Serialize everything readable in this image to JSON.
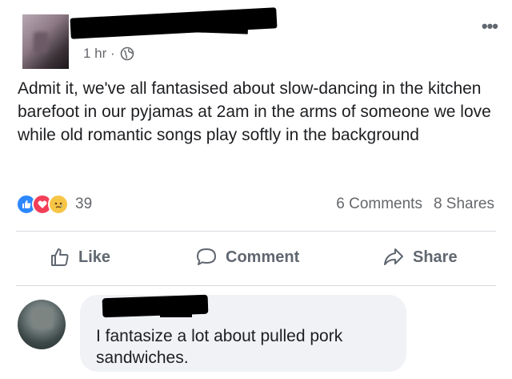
{
  "post": {
    "timestamp": "1 hr ·",
    "text": "Admit it, we've all fantasised about slow-dancing in the kitchen barefoot in our pyjamas at 2am in the arms of someone we love while old romantic songs play softly in the background",
    "reaction_count": "39",
    "comments_count": "6 Comments",
    "shares_count": "8 Shares",
    "more_icon": "•••"
  },
  "actions": {
    "like_label": "Like",
    "comment_label": "Comment",
    "share_label": "Share"
  },
  "comment": {
    "text": "I fantasize a lot about pulled pork sandwiches."
  },
  "colors": {
    "text": "#1c1e21",
    "secondary": "#65676b",
    "like_blue": "#2d88ff",
    "love_red": "#f33e58",
    "sad_yellow": "#f7c546",
    "bubble": "#f0f2f5"
  },
  "icons": [
    "globe-icon",
    "more-icon",
    "like-reaction-icon",
    "love-reaction-icon",
    "sad-reaction-icon",
    "thumbs-up-icon",
    "comment-icon",
    "share-icon"
  ]
}
